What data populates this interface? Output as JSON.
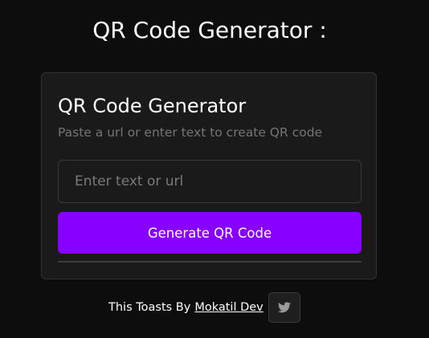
{
  "page": {
    "title": "QR Code Generator :"
  },
  "card": {
    "title": "QR Code Generator",
    "subtitle": "Paste a url or enter text to create QR code",
    "input_placeholder": "Enter text or url",
    "input_value": "",
    "button_label": "Generate QR Code"
  },
  "footer": {
    "text": "This Toasts By",
    "link_text": "Mokatil Dev",
    "icon": "twitter-icon"
  },
  "colors": {
    "background": "#0d0d0d",
    "card_background": "#1a1a1a",
    "accent": "#8800ff",
    "muted_text": "#757575"
  }
}
